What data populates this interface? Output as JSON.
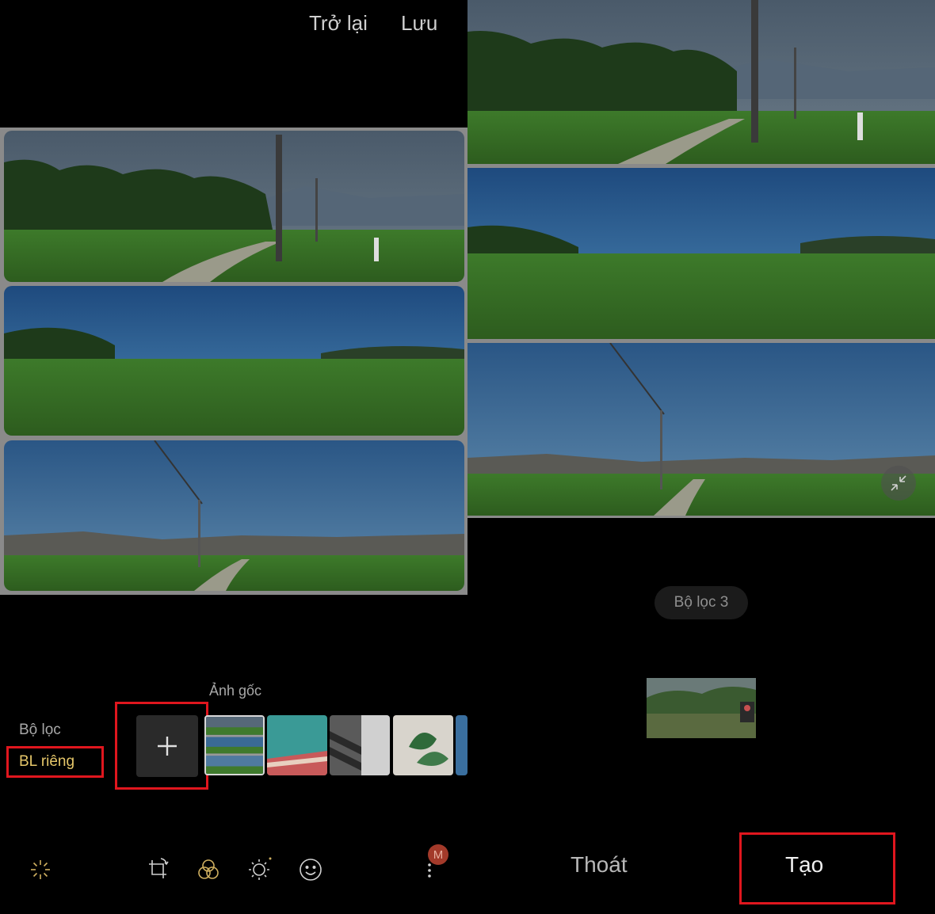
{
  "header": {
    "back_label": "Trở lại",
    "save_label": "Lưu"
  },
  "filter_panel": {
    "category_label": "Bộ lọc",
    "selected_category": "BL riêng",
    "original_label": "Ảnh gốc",
    "add_icon": "plus-icon"
  },
  "toolbar": {
    "icons": [
      "auto-enhance-icon",
      "crop-rotate-icon",
      "filter-icon",
      "brightness-icon",
      "sticker-icon",
      "more-icon"
    ],
    "badge_text": "M"
  },
  "right_panel": {
    "filter_name": "Bộ lọc 3",
    "exit_label": "Thoát",
    "create_label": "Tạo",
    "collapse_icon": "collapse-icon"
  },
  "colors": {
    "highlight": "#e0161e",
    "selected_text": "#e6c76a",
    "background": "#000000"
  }
}
